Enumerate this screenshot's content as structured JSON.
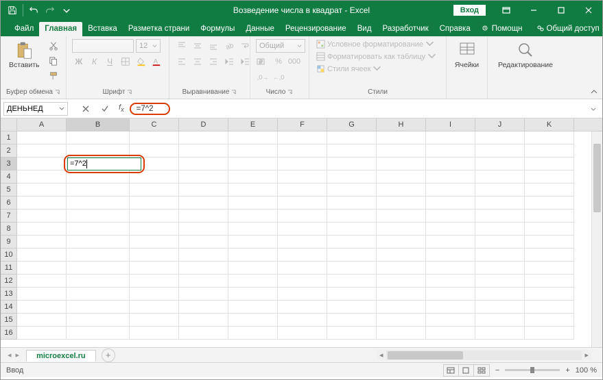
{
  "title": "Возведение числа в квадрат  -  Excel",
  "login": "Вход",
  "tabs": {
    "file": "Файл",
    "home": "Главная",
    "insert": "Вставка",
    "layout": "Разметка страни",
    "formulas": "Формулы",
    "data": "Данные",
    "review": "Рецензирование",
    "view": "Вид",
    "developer": "Разработчик",
    "help": "Справка",
    "tellme": "Помощн",
    "share": "Общий доступ"
  },
  "ribbon": {
    "clipboard": {
      "paste": "Вставить",
      "label": "Буфер обмена"
    },
    "font": {
      "name": "",
      "size": "12",
      "label": "Шрифт"
    },
    "align": {
      "label": "Выравнивание"
    },
    "number": {
      "format": "Общий",
      "label": "Число"
    },
    "styles": {
      "cond": "Условное форматирование",
      "table": "Форматировать как таблицу",
      "cell": "Стили ячеек",
      "label": "Стили"
    },
    "cells": {
      "label": "Ячейки"
    },
    "editing": {
      "label": "Редактирование"
    }
  },
  "formula_bar": {
    "namebox": "ДЕНЬНЕД",
    "formula": "=7^2"
  },
  "columns": [
    "A",
    "B",
    "C",
    "D",
    "E",
    "F",
    "G",
    "H",
    "I",
    "J",
    "K"
  ],
  "rows": [
    "1",
    "2",
    "3",
    "4",
    "5",
    "6",
    "7",
    "8",
    "9",
    "10",
    "11",
    "12",
    "13",
    "14",
    "15",
    "16"
  ],
  "active_cell": {
    "row": 3,
    "col": "B",
    "value": "=7^2"
  },
  "sheet": {
    "name": "microexcel.ru"
  },
  "status": {
    "mode": "Ввод",
    "zoom": "100 %"
  },
  "colors": {
    "accent": "#107c41",
    "highlight": "#da3b01"
  }
}
